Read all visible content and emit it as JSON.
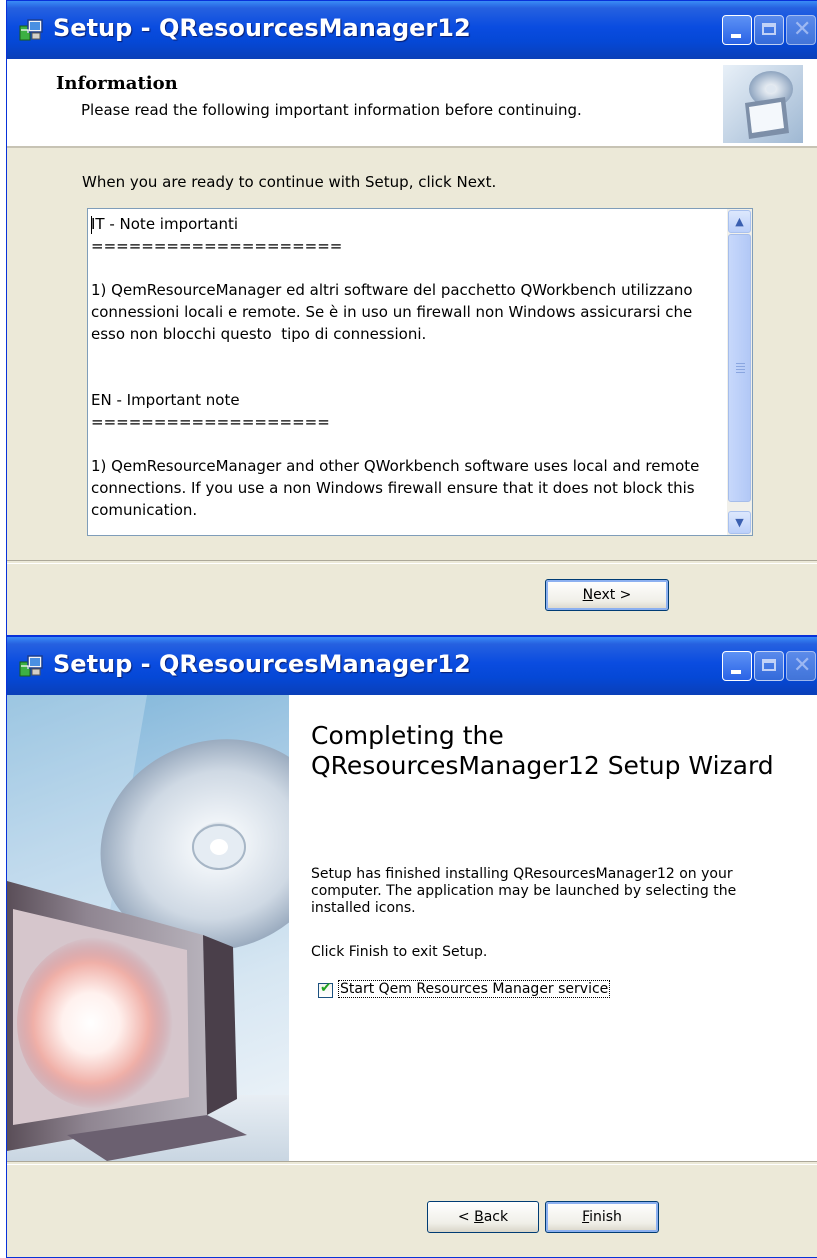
{
  "window1": {
    "title": "Setup - QResourcesManager12",
    "header": {
      "title": "Information",
      "subtitle": "Please read the following important information before continuing."
    },
    "instruction": "When you are ready to continue with Setup, click Next.",
    "memo_text": "IT - Note importanti\n====================\n\n1) QemResourceManager ed altri software del pacchetto QWorkbench utilizzano connessioni locali e remote. Se è in uso un firewall non Windows assicurarsi che esso non blocchi questo  tipo di connessioni.\n\n\nEN - Important note\n===================\n\n1) QemResourceManager and other QWorkbench software uses local and remote connections. If you use a non Windows firewall ensure that it does not block this comunication.",
    "buttons": {
      "next_mnemonic": "N",
      "next_rest": "ext >"
    }
  },
  "window2": {
    "title": "Setup - QResourcesManager12",
    "welcome_title": "Completing the QResourcesManager12 Setup Wizard",
    "finished_text": "Setup has finished installing QResourcesManager12 on your computer. The application may be launched by selecting the installed icons.",
    "click_finish": "Click Finish to exit Setup.",
    "checkbox": {
      "checked": true,
      "label": "Start Qem Resources Manager service"
    },
    "buttons": {
      "back_prefix": "< ",
      "back_mnemonic": "B",
      "back_rest": "ack",
      "finish_mnemonic": "F",
      "finish_rest": "inish"
    }
  },
  "icons": {
    "app": "setup-app-icon",
    "minimize": "minimize-icon",
    "maximize": "maximize-icon",
    "close": "close-icon",
    "scroll_up": "scroll-up-icon",
    "scroll_down": "scroll-down-icon",
    "wizard_header": "monitor-disc-image",
    "wizard_side": "monitor-cd-side-image"
  },
  "colors": {
    "titlebar": "#0a4ce0",
    "dialog_face": "#ece9d8",
    "button_border": "#003c74"
  }
}
